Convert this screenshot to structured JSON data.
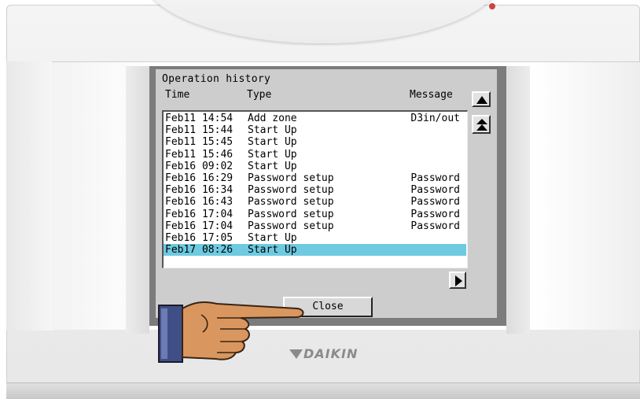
{
  "window": {
    "title": "Operation history"
  },
  "columns": {
    "time": "Time",
    "type": "Type",
    "message": "Message"
  },
  "history": [
    {
      "time": "Feb11 14:54",
      "type": "Add zone",
      "message": "D3in/out"
    },
    {
      "time": "Feb11 15:44",
      "type": "Start Up",
      "message": ""
    },
    {
      "time": "Feb11 15:45",
      "type": "Start Up",
      "message": ""
    },
    {
      "time": "Feb11 15:46",
      "type": "Start Up",
      "message": ""
    },
    {
      "time": "Feb16 09:02",
      "type": "Start Up",
      "message": ""
    },
    {
      "time": "Feb16 16:29",
      "type": "Password setup",
      "message": "Password"
    },
    {
      "time": "Feb16 16:34",
      "type": "Password setup",
      "message": "Password"
    },
    {
      "time": "Feb16 16:43",
      "type": "Password setup",
      "message": "Password"
    },
    {
      "time": "Feb16 17:04",
      "type": "Password setup",
      "message": "Password"
    },
    {
      "time": "Feb16 17:04",
      "type": "Password setup",
      "message": "Password"
    },
    {
      "time": "Feb16 17:05",
      "type": "Start Up",
      "message": ""
    },
    {
      "time": "Feb17 08:26",
      "type": "Start Up",
      "message": "",
      "selected": true
    }
  ],
  "buttons": {
    "close": "Close",
    "scroll_up_icon": "triangle-up-icon",
    "page_up_icon": "double-triangle-up-icon",
    "scroll_right_icon": "triangle-right-icon"
  },
  "brand": {
    "logo_text": "DAIKIN"
  },
  "colors": {
    "selected_row": "#6ecae0",
    "window_bg": "#cdcdcd",
    "screen_bg": "#7c7c7c"
  }
}
